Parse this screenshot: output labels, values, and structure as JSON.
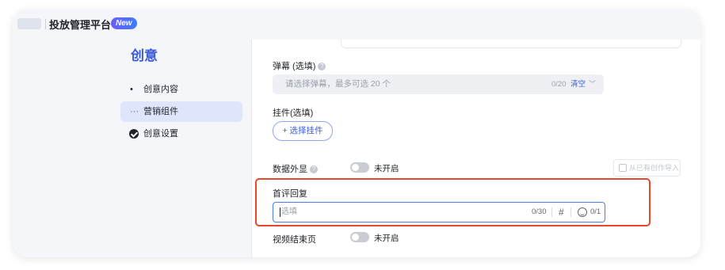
{
  "header": {
    "app_title": "投放管理平台",
    "new_badge": "New"
  },
  "sidebar": {
    "title": "创意",
    "items": [
      {
        "label": "创意内容",
        "mark": "•",
        "state": "default"
      },
      {
        "label": "营销组件",
        "mark": "···",
        "state": "active"
      },
      {
        "label": "创意设置",
        "mark": "check-circle-icon",
        "state": "done"
      }
    ]
  },
  "form": {
    "danmu": {
      "label": "弹幕 (选填)",
      "placeholder": "请选择弹幕，最多可选 20 个",
      "count": "0/20",
      "clear": "清空"
    },
    "pendant": {
      "label": "挂件(选填)",
      "button": "+ 选择挂件"
    },
    "data_display": {
      "label": "数据外显",
      "toggle_text": "未开启",
      "toggle_on": false,
      "import_button": "从已有创作导入"
    },
    "first_comment": {
      "label": "首评回复",
      "placeholder": "选填",
      "count": "0/30",
      "hash": "#",
      "emoji_count": "0/1"
    },
    "end_page": {
      "label": "视频结束页",
      "toggle_text": "未开启",
      "toggle_on": false
    }
  },
  "colors": {
    "accent": "#3a5bd9",
    "highlight": "#e8472c",
    "input_focus": "#4d7cf2"
  }
}
